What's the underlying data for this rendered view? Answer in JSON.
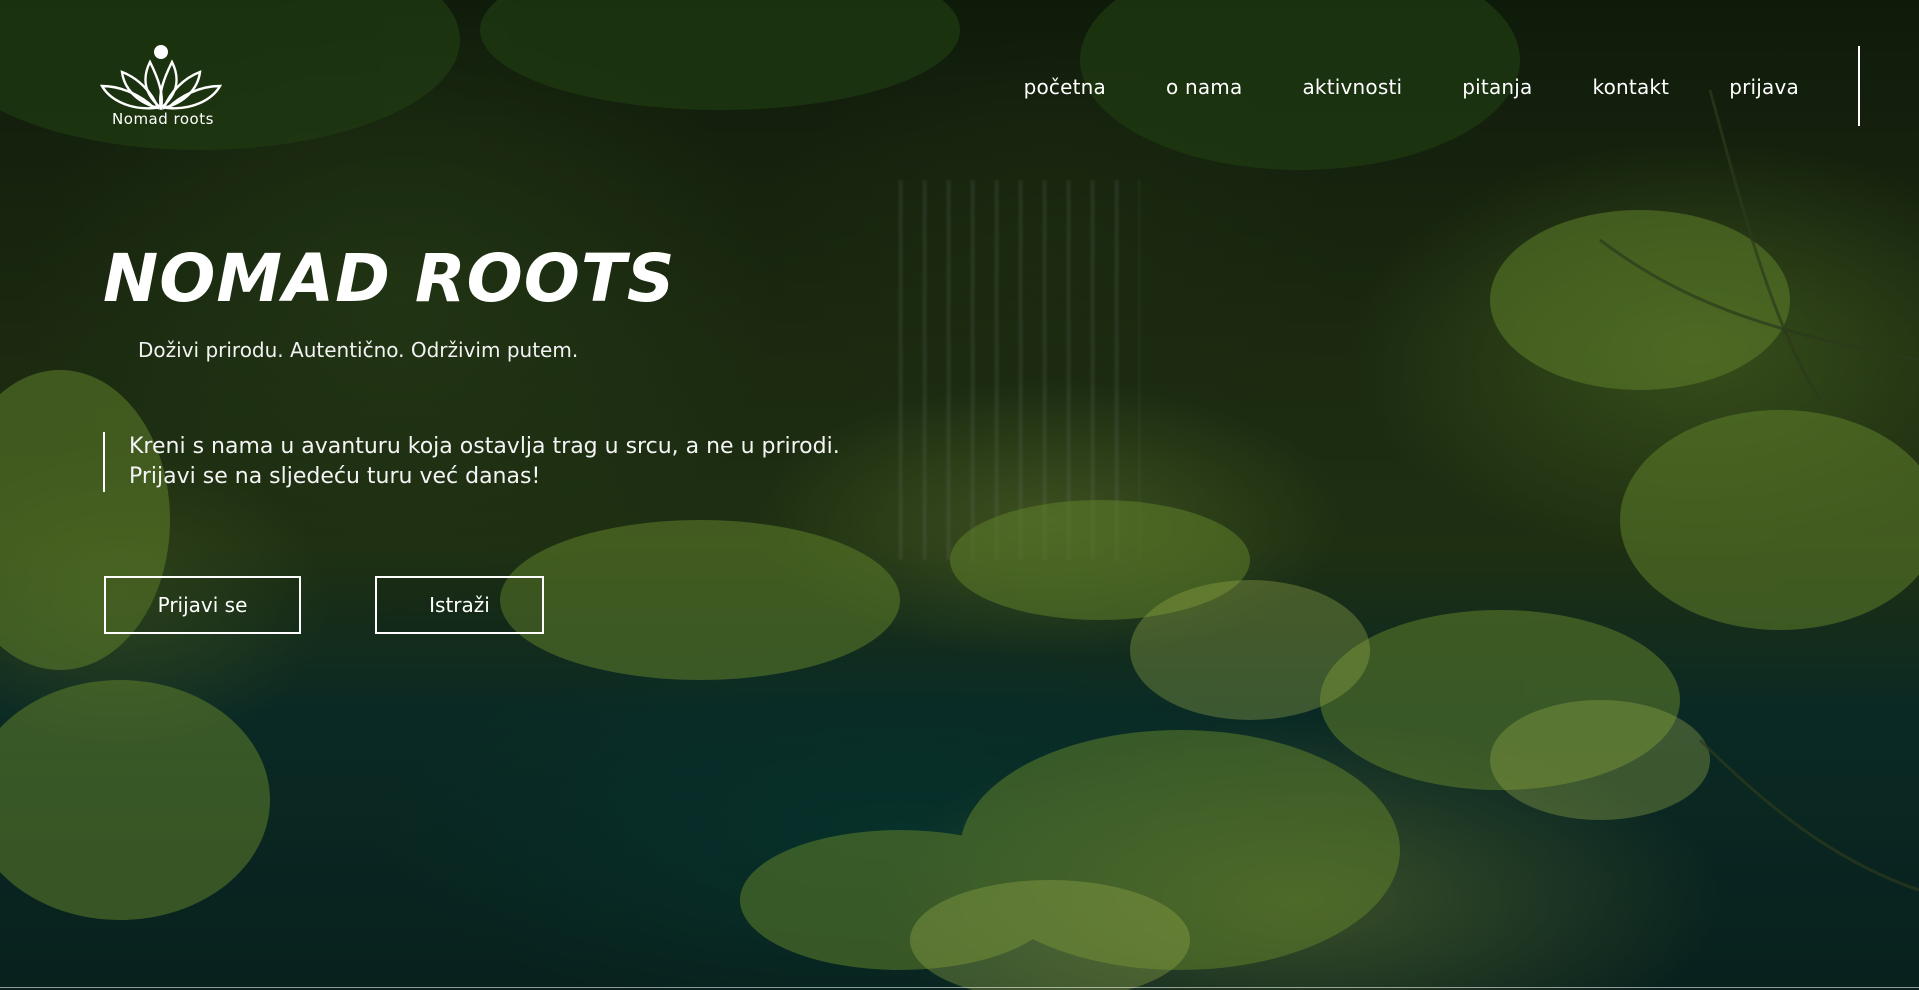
{
  "brand": {
    "name": "Nomad roots",
    "logo_icon": "lotus-leaves-icon"
  },
  "nav": {
    "items": [
      {
        "label": "početna"
      },
      {
        "label": "o nama"
      },
      {
        "label": "aktivnosti"
      },
      {
        "label": "pitanja"
      },
      {
        "label": "kontakt"
      },
      {
        "label": "prijava"
      }
    ]
  },
  "hero": {
    "title": "NOMAD ROOTS",
    "tagline": "Doživi prirodu. Autentično. Održivim putem.",
    "quote_line_1": "Kreni s nama u avanturu koja ostavlja trag u srcu, a ne u prirodi.",
    "quote_line_2": "Prijavi se na sljedeću turu već danas!",
    "primary_button": "Prijavi se",
    "secondary_button": "Istraži"
  },
  "colors": {
    "text": "#ffffff",
    "forest_dark": "#16260f",
    "lake": "#0f3a33"
  }
}
